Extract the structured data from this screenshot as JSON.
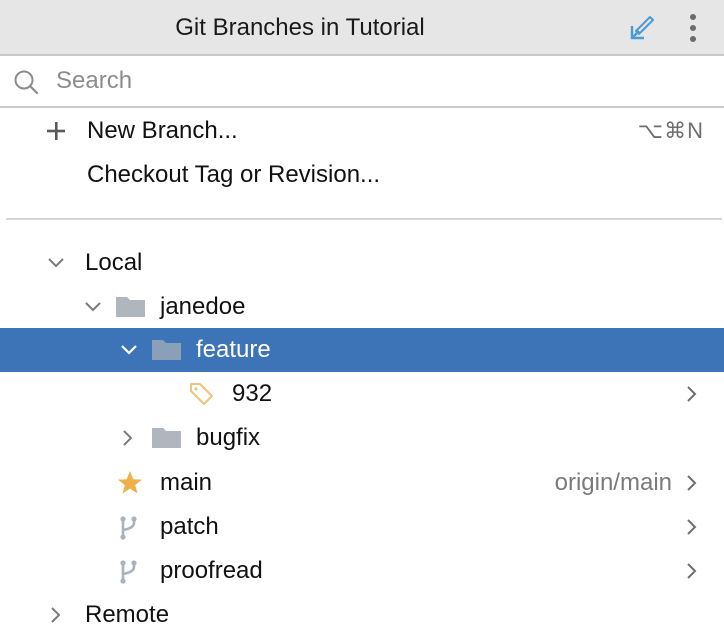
{
  "header": {
    "title": "Git Branches in Tutorial",
    "pin_icon": "pin-arrow-icon",
    "more_icon": "more-vertical-icon"
  },
  "search": {
    "placeholder": "Search",
    "value": "",
    "icon": "search-icon"
  },
  "actions": [
    {
      "label": "New Branch...",
      "icon": "plus-icon",
      "shortcut": "⌥⌘N"
    },
    {
      "label": "Checkout Tag or Revision...",
      "icon": "",
      "shortcut": ""
    }
  ],
  "tree": [
    {
      "label": "Local",
      "type": "group",
      "expanded": true
    },
    {
      "label": "janedoe",
      "type": "folder",
      "expanded": true
    },
    {
      "label": "feature",
      "type": "folder",
      "expanded": true,
      "selected": true
    },
    {
      "label": "932",
      "type": "tag-branch",
      "icon": "tag-icon",
      "has_submenu": true
    },
    {
      "label": "bugfix",
      "type": "folder",
      "expanded": false
    },
    {
      "label": "main",
      "type": "favorite-branch",
      "icon": "star-icon",
      "upstream": "origin/main",
      "has_submenu": true
    },
    {
      "label": "patch",
      "type": "branch",
      "icon": "branch-icon",
      "has_submenu": true
    },
    {
      "label": "proofread",
      "type": "branch",
      "icon": "branch-icon",
      "has_submenu": true
    },
    {
      "label": "Remote",
      "type": "group",
      "expanded": false
    }
  ],
  "colors": {
    "selection": "#3d74b8",
    "accent_blue": "#4a9ad8",
    "star": "#eeb04a",
    "tag": "#eec47a",
    "folder": "#b0b6bd",
    "header_bg": "#e6e6e6"
  }
}
